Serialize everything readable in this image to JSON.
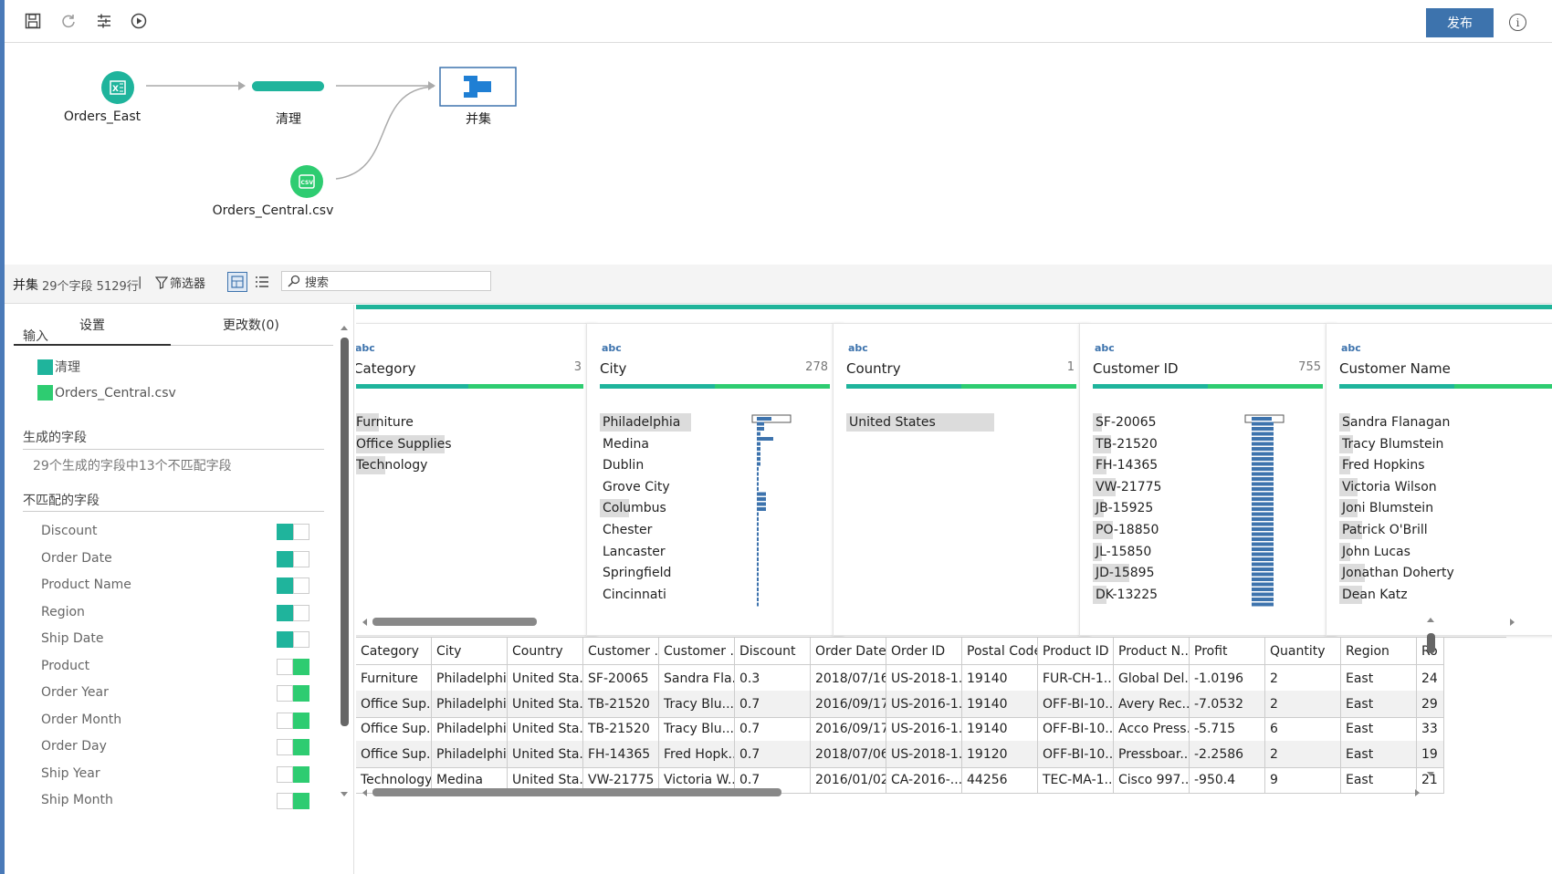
{
  "toolbar": {
    "publish_label": "发布",
    "info_label": "i"
  },
  "flow": {
    "nodes": [
      {
        "label": "Orders_East",
        "icon": "excel-icon"
      },
      {
        "label": "清理",
        "icon": "clean-step-icon"
      },
      {
        "label": "并集",
        "icon": "union-icon"
      },
      {
        "label": "Orders_Central.csv",
        "icon": "csv-icon"
      }
    ]
  },
  "status": {
    "step_name": "并集",
    "field_info": "29个字段 5129行",
    "divider": "|",
    "filter_label": "筛选器",
    "search_placeholder": "搜索"
  },
  "left": {
    "tab_settings": "设置",
    "tab_changes": "更改数(0)",
    "input_heading": "输入",
    "inputs": [
      {
        "label": "清理",
        "color": "#1fb49c"
      },
      {
        "label": "Orders_Central.csv",
        "color": "#2ecc71"
      }
    ],
    "generated_heading": "生成的字段",
    "generated_text": "29个生成的字段中13个不匹配字段",
    "mismatch_heading": "不匹配的字段",
    "fields": [
      {
        "name": "Discount",
        "source": "left"
      },
      {
        "name": "Order Date",
        "source": "left"
      },
      {
        "name": "Product Name",
        "source": "left"
      },
      {
        "name": "Region",
        "source": "left"
      },
      {
        "name": "Ship Date",
        "source": "left"
      },
      {
        "name": "Product",
        "source": "right"
      },
      {
        "name": "Order Year",
        "source": "right"
      },
      {
        "name": "Order Month",
        "source": "right"
      },
      {
        "name": "Order Day",
        "source": "right"
      },
      {
        "name": "Ship Year",
        "source": "right"
      },
      {
        "name": "Ship Month",
        "source": "right"
      }
    ]
  },
  "profile_cards": [
    {
      "type": "abc",
      "name": "Category",
      "count": "3",
      "values": [
        "Furniture",
        "Office Supplies",
        "Technology"
      ]
    },
    {
      "type": "abc",
      "name": "City",
      "count": "278",
      "values": [
        "Philadelphia",
        "Medina",
        "Dublin",
        "Grove City",
        "Columbus",
        "Chester",
        "Lancaster",
        "Springfield",
        "Cincinnati"
      ]
    },
    {
      "type": "abc",
      "name": "Country",
      "count": "1",
      "values": [
        "United States"
      ]
    },
    {
      "type": "abc",
      "name": "Customer ID",
      "count": "755",
      "values": [
        "SF-20065",
        "TB-21520",
        "FH-14365",
        "VW-21775",
        "JB-15925",
        "PO-18850",
        "JL-15850",
        "JD-15895",
        "DK-13225"
      ]
    },
    {
      "type": "abc",
      "name": "Customer Name",
      "count": "",
      "values": [
        "Sandra Flanagan",
        "Tracy Blumstein",
        "Fred Hopkins",
        "Victoria Wilson",
        "Joni Blumstein",
        "Patrick O'Brill",
        "John Lucas",
        "Jonathan Doherty",
        "Dean Katz"
      ]
    }
  ],
  "table": {
    "columns": [
      "Category",
      "City",
      "Country",
      "Customer ...",
      "Customer ...",
      "Discount",
      "Order Date",
      "Order ID",
      "Postal Code",
      "Product ID",
      "Product N...",
      "Profit",
      "Quantity",
      "Region",
      "Ro"
    ],
    "rows": [
      [
        "Furniture",
        "Philadelphia",
        "United Sta...",
        "SF-20065",
        "Sandra Fla...",
        "0.3",
        "2018/07/16",
        "US-2018-1...",
        "19140",
        "FUR-CH-1...",
        "Global Del...",
        "-1.0196",
        "2",
        "East",
        "24"
      ],
      [
        "Office Sup...",
        "Philadelphia",
        "United Sta...",
        "TB-21520",
        "Tracy Blu...",
        "0.7",
        "2016/09/17",
        "US-2016-1...",
        "19140",
        "OFF-BI-10...",
        "Avery Rec...",
        "-7.0532",
        "2",
        "East",
        "29"
      ],
      [
        "Office Sup...",
        "Philadelphia",
        "United Sta...",
        "TB-21520",
        "Tracy Blu...",
        "0.7",
        "2016/09/17",
        "US-2016-1...",
        "19140",
        "OFF-BI-10...",
        "Acco Press...",
        "-5.715",
        "6",
        "East",
        "33"
      ],
      [
        "Office Sup...",
        "Philadelphia",
        "United Sta...",
        "FH-14365",
        "Fred Hopk...",
        "0.7",
        "2018/07/06",
        "US-2018-1...",
        "19120",
        "OFF-BI-10...",
        "Pressboar...",
        "-2.2586",
        "2",
        "East",
        "19"
      ],
      [
        "Technology",
        "Medina",
        "United Sta...",
        "VW-21775",
        "Victoria W...",
        "0.7",
        "2016/01/02",
        "CA-2016-...",
        "44256",
        "TEC-MA-1...",
        "Cisco 997...",
        "-950.4",
        "9",
        "East",
        "21"
      ]
    ]
  }
}
